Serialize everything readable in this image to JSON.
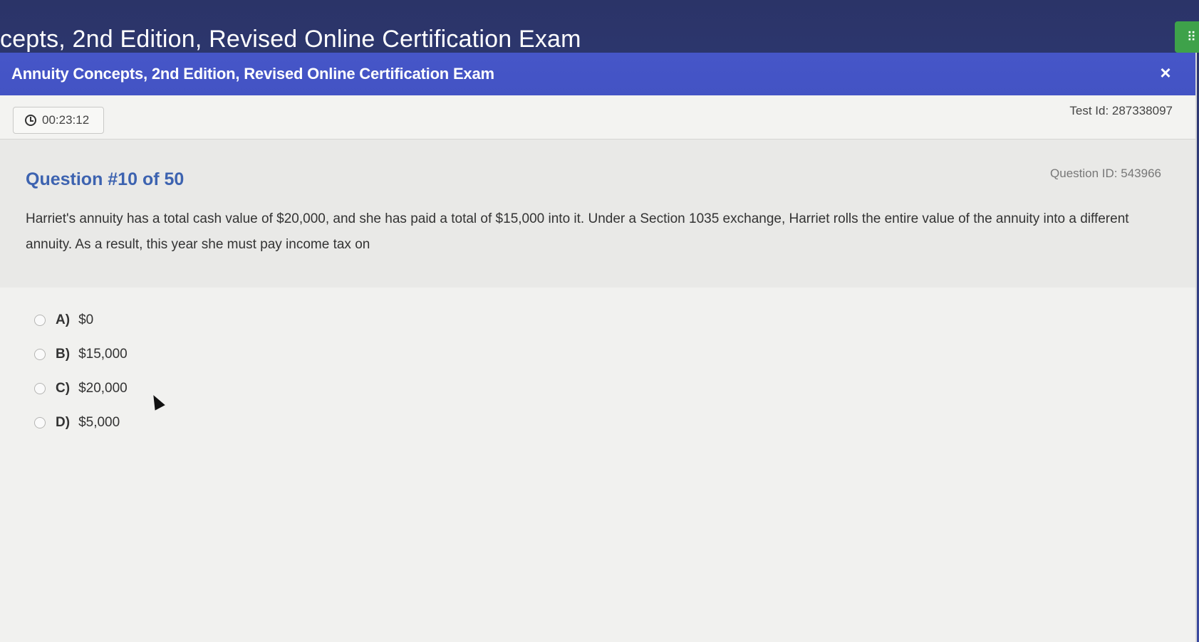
{
  "window": {
    "background_title": "cepts, 2nd Edition, Revised Online Certification Exam"
  },
  "modal": {
    "title": "Annuity Concepts, 2nd Edition, Revised Online Certification Exam",
    "close_label": "×"
  },
  "toolbar": {
    "timer": "00:23:12",
    "test_id": "Test Id: 287338097"
  },
  "question": {
    "title": "Question #10 of 50",
    "id_label": "Question ID: 543966",
    "text": "Harriet's annuity has a total cash value of $20,000, and she has paid a total of $15,000 into it. Under a Section 1035 exchange, Harriet rolls the entire value of the annuity into a different annuity. As a result, this year she must pay income tax on"
  },
  "options": [
    {
      "letter": "A)",
      "text": "$0"
    },
    {
      "letter": "B)",
      "text": "$15,000"
    },
    {
      "letter": "C)",
      "text": "$20,000"
    },
    {
      "letter": "D)",
      "text": "$5,000"
    }
  ],
  "colors": {
    "header_blue": "#4353c4",
    "question_title_blue": "#3d63b0",
    "side_tab_green": "#3ea24a"
  }
}
